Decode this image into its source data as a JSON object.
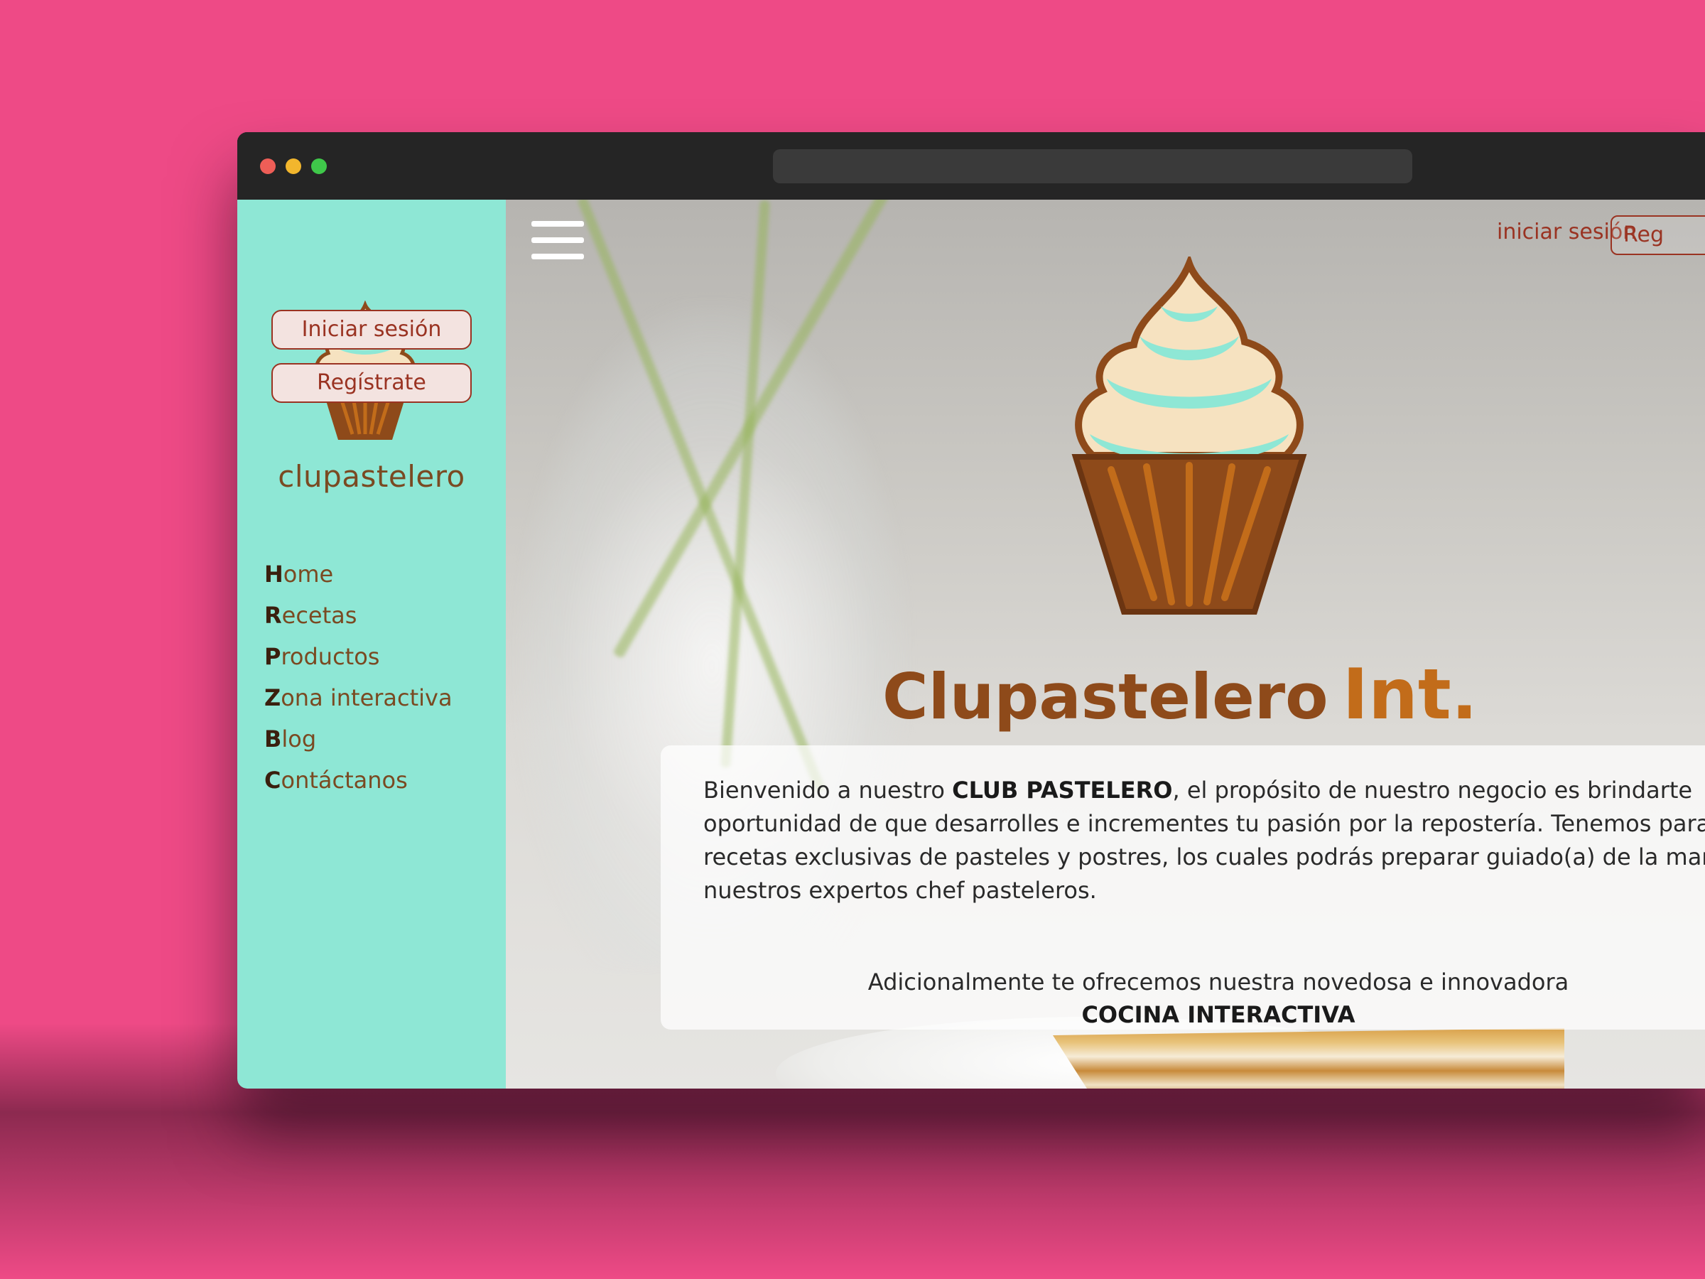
{
  "colors": {
    "background": "#ee4a86",
    "sidebar": "#8ee7d5",
    "accent": "#9a3322",
    "brand_brown": "#8e4a1a",
    "brand_orange": "#c26c1a"
  },
  "sidebar": {
    "brand": "clupastelero",
    "nav": [
      {
        "cap": "H",
        "rest": "ome"
      },
      {
        "cap": "R",
        "rest": "ecetas"
      },
      {
        "cap": "P",
        "rest": "roductos"
      },
      {
        "cap": "Z",
        "rest": "ona interactiva"
      },
      {
        "cap": "B",
        "rest": "log"
      },
      {
        "cap": "C",
        "rest": "ontáctanos"
      }
    ],
    "login_label": "Iniciar sesión",
    "register_label": "Regístrate"
  },
  "header": {
    "login_label": "iniciar sesión",
    "register_label": "Reg"
  },
  "hero": {
    "title_main": "Clupastelero",
    "title_suffix": "Int.",
    "intro_before": "Bienvenido a nuestro ",
    "intro_bold": "CLUB PASTELERO",
    "intro_line1_after": ", el propósito de nuestro negocio es brindarte",
    "intro_line2": "oportunidad de que desarrolles e incrementes tu pasión por la repostería. Tenemos para",
    "intro_line3": "recetas exclusivas de pasteles y postres, los cuales podrás preparar guiado(a) de la mano d",
    "intro_line4": "nuestros expertos chef pasteleros.",
    "additional": "Adicionalmente te ofrecemos nuestra novedosa e innovadora",
    "cocina": "COCINA INTERACTIVA"
  }
}
